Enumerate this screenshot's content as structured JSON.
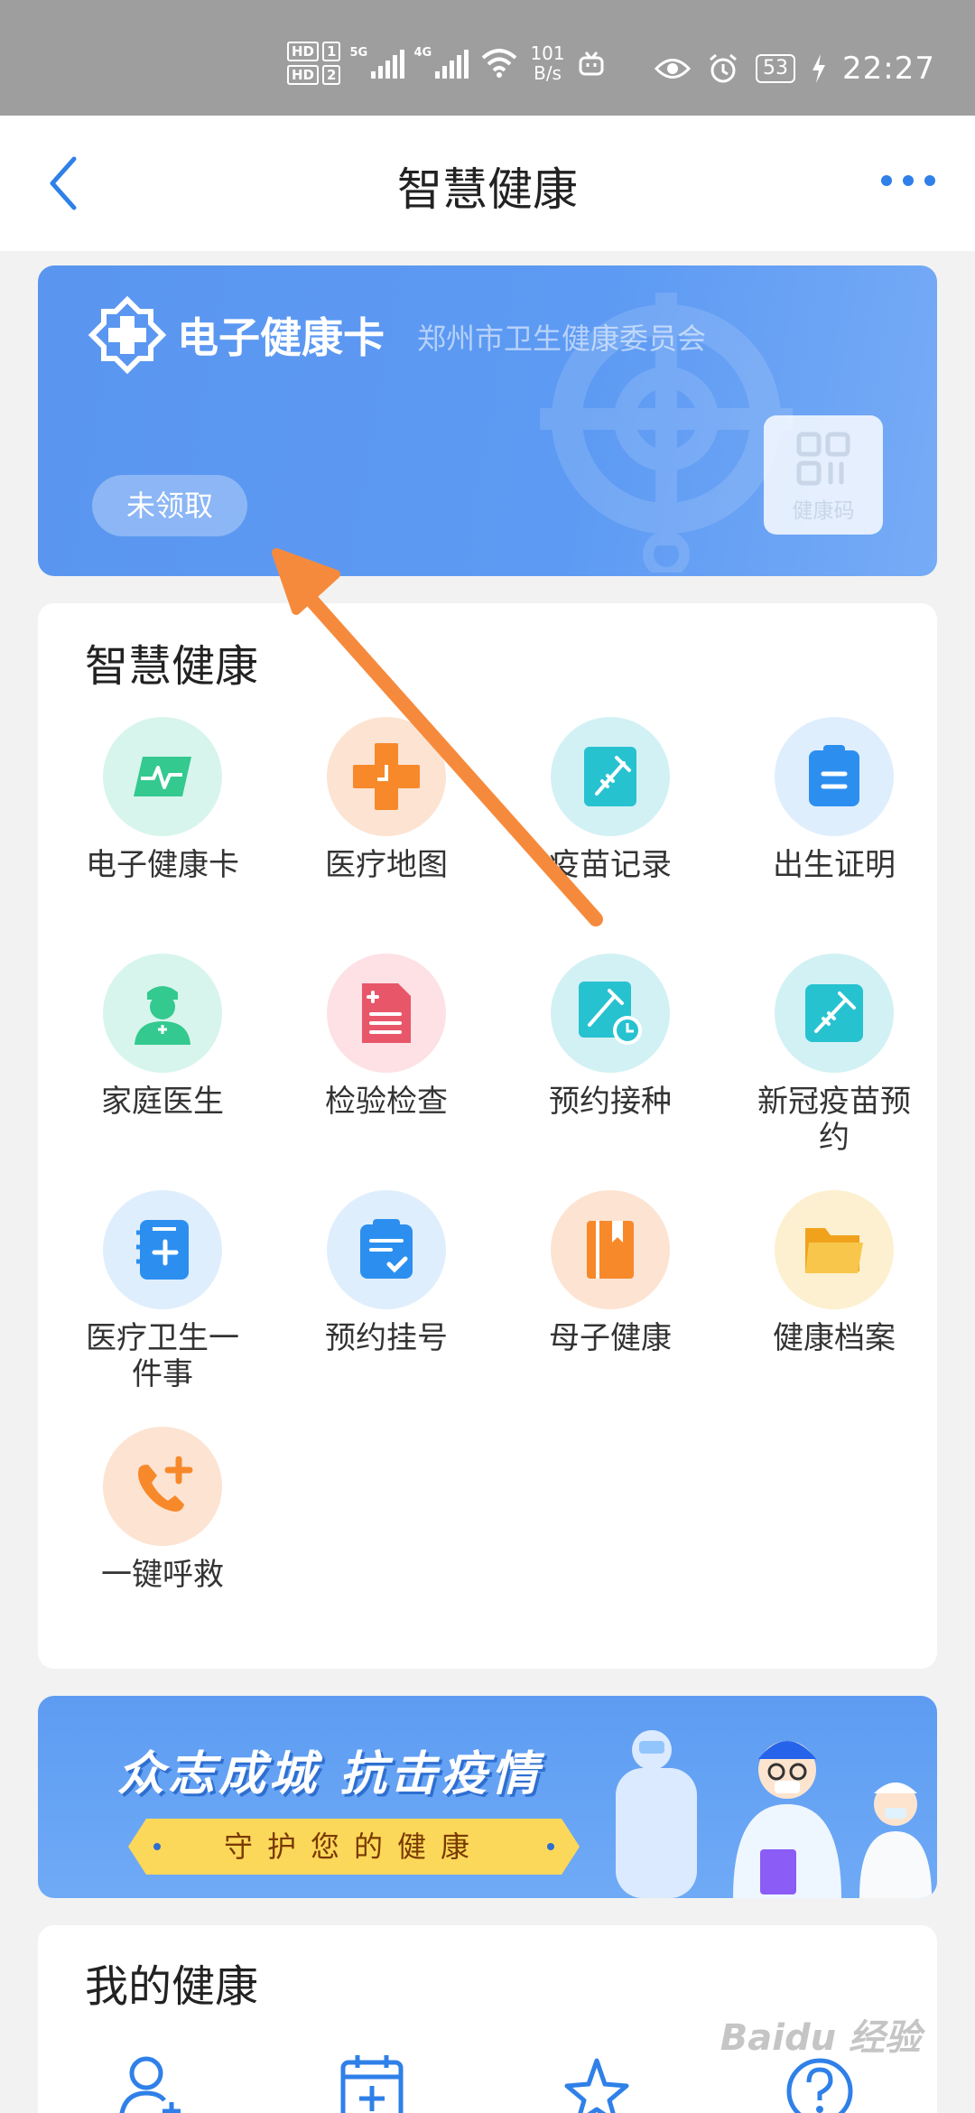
{
  "status_bar": {
    "sim1": "HD",
    "sim1_slot": "1",
    "sim2": "HD",
    "sim2_slot": "2",
    "net1": "5G",
    "net2": "4G",
    "speed_value": "101",
    "speed_unit": "B/s",
    "battery": "53",
    "time": "22:27"
  },
  "nav": {
    "title": "智慧健康"
  },
  "health_card": {
    "title": "电子健康卡",
    "issuer": "郑州市卫生健康委员会",
    "claim_status": "未领取",
    "qr_label": "健康码"
  },
  "services": {
    "title": "智慧健康",
    "items": [
      {
        "label": "电子健康卡",
        "icon": "heartbeat-card-icon",
        "bg": "#d7f5ec",
        "fg": "#33c98f"
      },
      {
        "label": "医疗地图",
        "icon": "medical-cross-icon",
        "bg": "#fde3d2",
        "fg": "#f7892a"
      },
      {
        "label": "疫苗记录",
        "icon": "vaccine-record-icon",
        "bg": "#d2f1f4",
        "fg": "#27c2d0"
      },
      {
        "label": "出生证明",
        "icon": "clipboard-icon",
        "bg": "#dfeefd",
        "fg": "#2c8ff0"
      },
      {
        "label": "家庭医生",
        "icon": "doctor-icon",
        "bg": "#d7f5ec",
        "fg": "#33c98f"
      },
      {
        "label": "检验检查",
        "icon": "medical-document-icon",
        "bg": "#fde1e5",
        "fg": "#e8566a"
      },
      {
        "label": "预约接种",
        "icon": "vaccine-schedule-icon",
        "bg": "#d2f1f4",
        "fg": "#27c2d0"
      },
      {
        "label": "新冠疫苗预约",
        "icon": "covid-vaccine-icon",
        "bg": "#d2f1f4",
        "fg": "#27c2d0"
      },
      {
        "label": "医疗卫生一件事",
        "icon": "medical-notebook-icon",
        "bg": "#dfeefd",
        "fg": "#2c8ff0"
      },
      {
        "label": "预约挂号",
        "icon": "appointment-clipboard-icon",
        "bg": "#dfeefd",
        "fg": "#2c8ff0"
      },
      {
        "label": "母子健康",
        "icon": "maternal-book-icon",
        "bg": "#fde3d2",
        "fg": "#f7892a"
      },
      {
        "label": "健康档案",
        "icon": "folder-icon",
        "bg": "#fdf0d0",
        "fg": "#f6b52c"
      },
      {
        "label": "一键呼救",
        "icon": "emergency-call-icon",
        "bg": "#fde3d2",
        "fg": "#f7892a"
      }
    ]
  },
  "banner": {
    "headline": "众志成城 抗击疫情",
    "subline": "守护您的健康"
  },
  "my_health": {
    "title": "我的健康",
    "tools": [
      {
        "icon": "add-user-icon"
      },
      {
        "icon": "calendar-add-icon"
      },
      {
        "icon": "star-icon"
      },
      {
        "icon": "help-icon"
      }
    ]
  },
  "watermark": "Baidu 经验",
  "colors": {
    "accent": "#2f80e8",
    "card": "#5d9af3",
    "arrow": "#f68a3c"
  }
}
